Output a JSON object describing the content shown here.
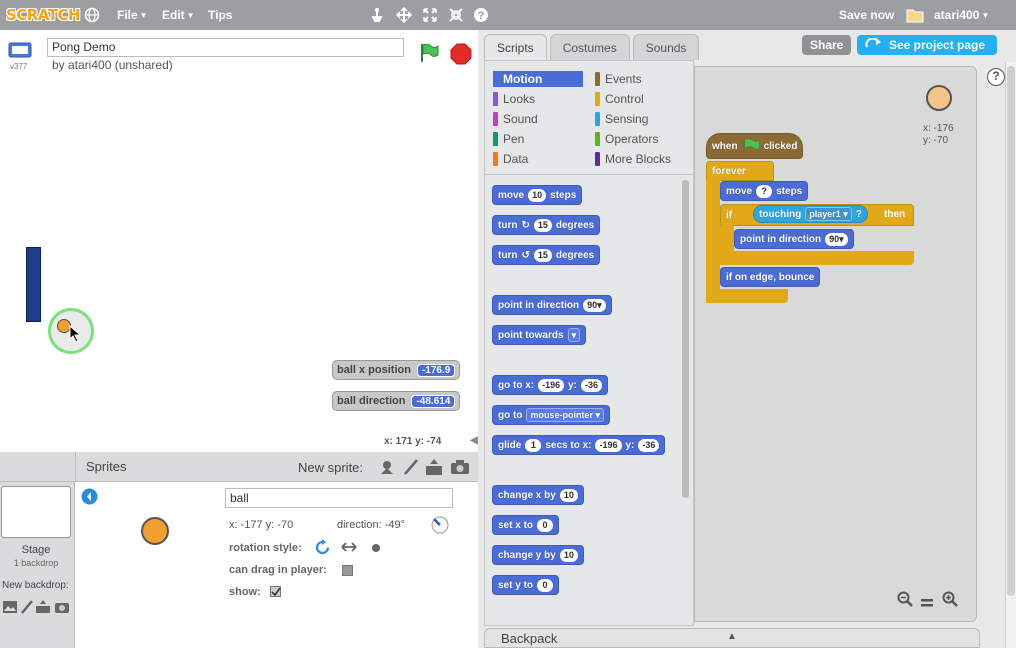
{
  "menubar": {
    "logo": "SCRATCH",
    "file": "File",
    "edit": "Edit",
    "tips": "Tips",
    "save_now": "Save now",
    "username": "atari400"
  },
  "stage_header": {
    "version": "v377",
    "project_title": "Pong Demo",
    "by_line": "by atari400 (unshared)"
  },
  "monitors": [
    {
      "label": "ball x position",
      "value": "-176.9"
    },
    {
      "label": "ball direction",
      "value": "-48.614"
    }
  ],
  "stage_status": {
    "coords": "x: 171  y: -74"
  },
  "sprites_pane": {
    "header": "Sprites",
    "new_sprite": "New sprite:",
    "stage_label": "Stage",
    "backdrop_count": "1 backdrop",
    "new_backdrop": "New backdrop:",
    "sprite_name": "ball",
    "xy": "x: -177  y: -70",
    "direction": "direction: -49°",
    "rotation_style": "rotation style:",
    "can_drag": "can drag in player:",
    "show": "show:"
  },
  "top_buttons": {
    "share": "Share",
    "see_project_page": "See project page"
  },
  "tabs": [
    "Scripts",
    "Costumes",
    "Sounds"
  ],
  "categories": [
    {
      "label": "Motion",
      "color": "#4a6cd4"
    },
    {
      "label": "Events",
      "color": "#8c6a34"
    },
    {
      "label": "Looks",
      "color": "#8a55d7"
    },
    {
      "label": "Control",
      "color": "#e1a91a"
    },
    {
      "label": "Sound",
      "color": "#bb42c3"
    },
    {
      "label": "Sensing",
      "color": "#2ca5e2"
    },
    {
      "label": "Pen",
      "color": "#0e9a6c"
    },
    {
      "label": "Operators",
      "color": "#5cb712"
    },
    {
      "label": "Data",
      "color": "#ee7d16"
    },
    {
      "label": "More Blocks",
      "color": "#632d99"
    }
  ],
  "palette_blocks": {
    "move": {
      "pre": "move",
      "n": "10",
      "post": "steps"
    },
    "turn_cw": {
      "pre": "turn",
      "n": "15",
      "post": "degrees"
    },
    "turn_ccw": {
      "pre": "turn",
      "n": "15",
      "post": "degrees"
    },
    "point_dir": {
      "pre": "point in direction",
      "n": "90▾"
    },
    "point_towards": {
      "pre": "point towards",
      "n": "▾"
    },
    "goto_xy": {
      "pre": "go to x:",
      "x": "-196",
      "mid": "y:",
      "y": "-36"
    },
    "goto": {
      "pre": "go to",
      "n": "mouse-pointer ▾"
    },
    "glide": {
      "pre": "glide",
      "n": "1",
      "mid": "secs to x:",
      "x": "-196",
      "mid2": "y:",
      "y": "-36"
    },
    "change_x": {
      "pre": "change x by",
      "n": "10"
    },
    "set_x": {
      "pre": "set x to",
      "n": "0"
    },
    "change_y": {
      "pre": "change y by",
      "n": "10"
    },
    "set_y": {
      "pre": "set y to",
      "n": "0"
    }
  },
  "script": {
    "hat": {
      "pre": "when",
      "post": "clicked"
    },
    "forever": "forever",
    "move": {
      "pre": "move",
      "n": "?",
      "post": "steps"
    },
    "if": "if",
    "touching": {
      "pre": "touching",
      "n": "player1 ▾",
      "q": "?"
    },
    "then": "then",
    "point_dir": {
      "pre": "point in direction",
      "n": "90▾"
    },
    "bounce": "if on edge, bounce",
    "sprite_xy": {
      "x": "x: -176",
      "y": "y: -70"
    }
  },
  "backpack": "Backpack",
  "colors": {
    "menubar": "#9c9ea2",
    "accent": "#4a6cd4",
    "share": "#8f9194",
    "see_page": "#25aff4"
  }
}
